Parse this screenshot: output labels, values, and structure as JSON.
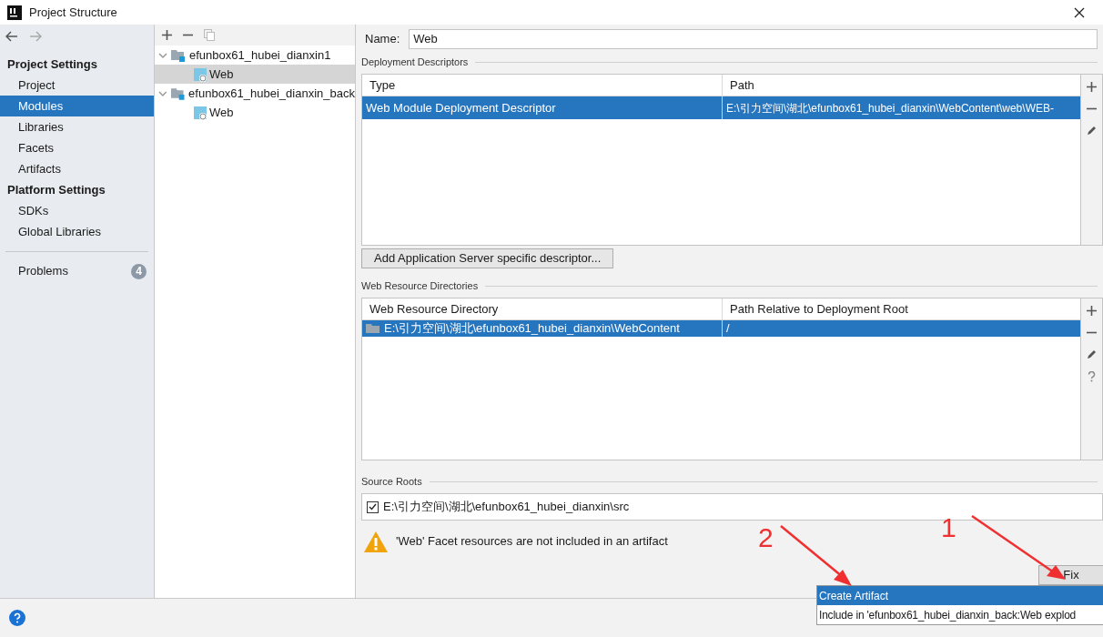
{
  "window": {
    "title": "Project Structure"
  },
  "sidebar": {
    "sections": [
      {
        "title": "Project Settings",
        "items": [
          {
            "label": "Project",
            "selected": false
          },
          {
            "label": "Modules",
            "selected": true
          },
          {
            "label": "Libraries",
            "selected": false
          },
          {
            "label": "Facets",
            "selected": false
          },
          {
            "label": "Artifacts",
            "selected": false
          }
        ]
      },
      {
        "title": "Platform Settings",
        "items": [
          {
            "label": "SDKs",
            "selected": false
          },
          {
            "label": "Global Libraries",
            "selected": false
          }
        ]
      }
    ],
    "problems": {
      "label": "Problems",
      "count": "4"
    }
  },
  "module_tree": [
    {
      "label": "efunbox61_hubei_dianxin1",
      "expanded": true,
      "selected": false,
      "children": [
        {
          "label": "Web",
          "selected": true
        }
      ]
    },
    {
      "label": "efunbox61_hubei_dianxin_back",
      "expanded": true,
      "selected": false,
      "children": [
        {
          "label": "Web",
          "selected": false
        }
      ]
    }
  ],
  "name_field": {
    "label": "Name:",
    "value": "Web"
  },
  "deployment_descriptors": {
    "title": "Deployment Descriptors",
    "columns": [
      "Type",
      "Path"
    ],
    "rows": [
      {
        "cells": [
          "Web Module Deployment Descriptor",
          "E:\\引力空间\\湖北\\efunbox61_hubei_dianxin\\WebContent\\web\\WEB-"
        ],
        "selected": true
      }
    ],
    "add_button": "Add Application Server specific descriptor..."
  },
  "web_resource_directories": {
    "title": "Web Resource Directories",
    "columns": [
      "Web Resource Directory",
      "Path Relative to Deployment Root"
    ],
    "rows": [
      {
        "cells": [
          "E:\\引力空间\\湖北\\efunbox61_hubei_dianxin\\WebContent",
          "/"
        ],
        "selected": true
      }
    ]
  },
  "source_roots": {
    "title": "Source Roots",
    "items": [
      {
        "path": "E:\\引力空间\\湖北\\efunbox61_hubei_dianxin\\src",
        "checked": true
      }
    ]
  },
  "warning": "'Web' Facet resources are not included in an artifact",
  "fix_button": "Fix",
  "fix_popup": [
    {
      "label": "Create Artifact",
      "selected": true
    },
    {
      "label": "Include in 'efunbox61_hubei_dianxin_back:Web explod",
      "selected": false
    }
  ],
  "annotations": [
    "1",
    "2"
  ]
}
